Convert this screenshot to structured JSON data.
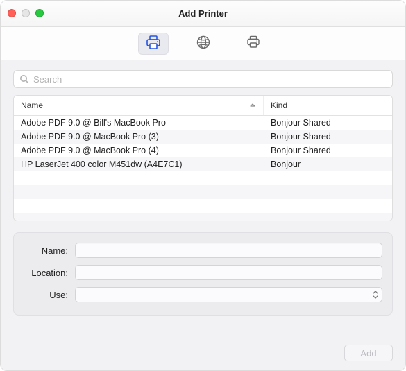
{
  "window": {
    "title": "Add Printer"
  },
  "toolbar": {
    "tabs": [
      {
        "id": "default",
        "icon": "printer-icon",
        "selected": true
      },
      {
        "id": "ip",
        "icon": "globe-icon",
        "selected": false
      },
      {
        "id": "windows",
        "icon": "network-printer-icon",
        "selected": false
      }
    ]
  },
  "search": {
    "placeholder": "Search",
    "value": ""
  },
  "table": {
    "columns": {
      "name": "Name",
      "kind": "Kind"
    },
    "sort": {
      "column": "name",
      "direction": "asc"
    },
    "rows": [
      {
        "name": "Adobe PDF 9.0 @ Bill's MacBook Pro",
        "kind": "Bonjour Shared"
      },
      {
        "name": "Adobe PDF 9.0 @ MacBook Pro (3)",
        "kind": "Bonjour Shared"
      },
      {
        "name": "Adobe PDF 9.0 @ MacBook Pro (4)",
        "kind": "Bonjour Shared"
      },
      {
        "name": "HP LaserJet 400 color M451dw (A4E7C1)",
        "kind": "Bonjour"
      }
    ]
  },
  "form": {
    "labels": {
      "name": "Name:",
      "location": "Location:",
      "use": "Use:"
    },
    "values": {
      "name": "",
      "location": "",
      "use": ""
    }
  },
  "footer": {
    "add_label": "Add",
    "add_enabled": false
  },
  "colors": {
    "accent": "#2655e0"
  }
}
